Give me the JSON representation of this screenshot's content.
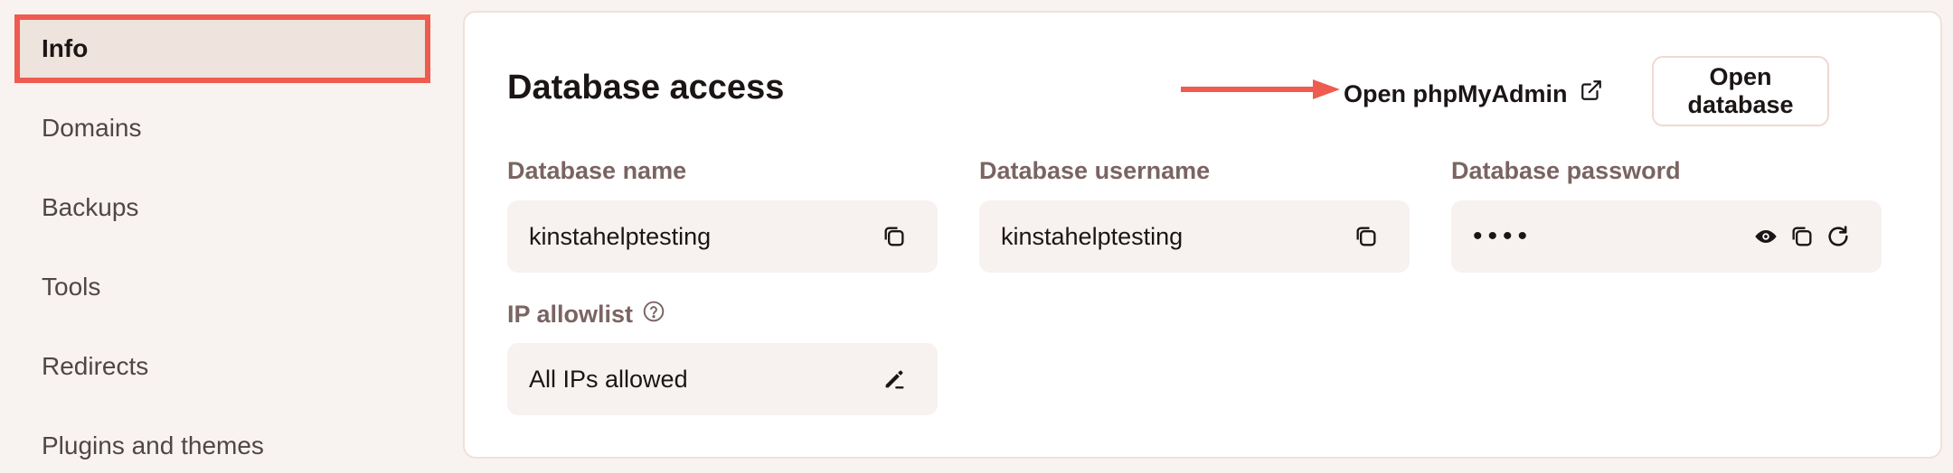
{
  "sidebar": {
    "items": [
      {
        "label": "Info",
        "active": true
      },
      {
        "label": "Domains"
      },
      {
        "label": "Backups"
      },
      {
        "label": "Tools"
      },
      {
        "label": "Redirects"
      },
      {
        "label": "Plugins and themes"
      }
    ]
  },
  "card": {
    "title": "Database access",
    "phpmyadmin_label": "Open phpMyAdmin",
    "open_database_label": "Open database",
    "fields": {
      "db_name": {
        "label": "Database name",
        "value": "kinstahelptesting"
      },
      "db_username": {
        "label": "Database username",
        "value": "kinstahelptesting"
      },
      "db_password": {
        "label": "Database password",
        "value": "••••"
      },
      "ip_allowlist": {
        "label": "IP allowlist",
        "value": "All IPs allowed"
      }
    }
  },
  "colors": {
    "highlight": "#ef5b4f",
    "label": "#7a6462",
    "field_bg": "#f7f2ef",
    "page_bg": "#f8f3f0"
  },
  "icons": [
    "external-link-icon",
    "copy-icon",
    "eye-icon",
    "refresh-icon",
    "help-icon",
    "edit-icon"
  ]
}
